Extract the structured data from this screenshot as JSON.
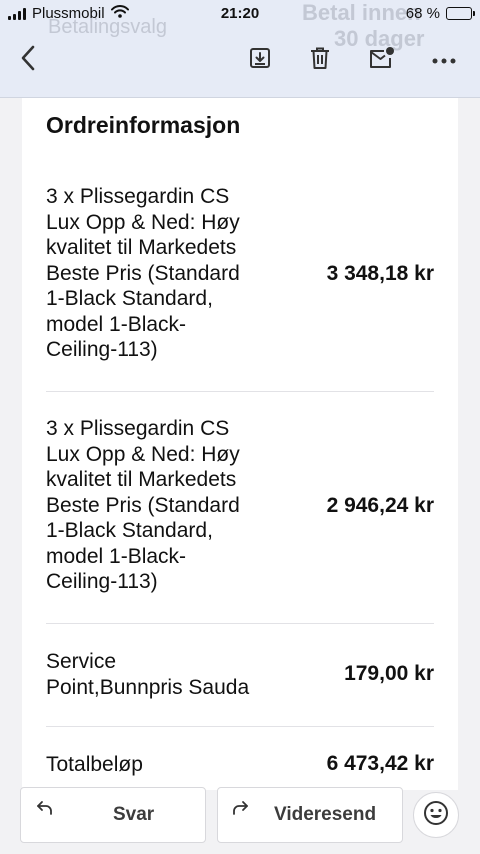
{
  "status_bar": {
    "carrier": "Plussmobil",
    "time": "21:20",
    "battery_percent": "68 %",
    "battery_level": 0.68
  },
  "background_header": {
    "left_text": "Betalingsvalg",
    "right_line1": "Betal innen",
    "right_line2": "30 dager"
  },
  "toolbar": {
    "back_icon": "back-arrow-icon",
    "archive_icon": "archive-icon",
    "delete_icon": "trash-icon",
    "unread_icon": "mark-unread-icon",
    "more_icon": "more-icon"
  },
  "order": {
    "title": "Ordreinformasjon",
    "items": [
      {
        "desc_lines": [
          "3 x Plissegardin CS",
          "Lux Opp & Ned: Høy",
          "kvalitet til Markedets",
          "Beste Pris (Standard",
          "1-Black Standard,",
          "model 1-Black-",
          "Ceiling-113)"
        ],
        "price": "3 348,18 kr"
      },
      {
        "desc_lines": [
          "3 x Plissegardin CS",
          "Lux Opp & Ned: Høy",
          "kvalitet til Markedets",
          "Beste Pris (Standard",
          "1-Black Standard,",
          "model 1-Black-",
          "Ceiling-113)"
        ],
        "price": "2 946,24 kr"
      },
      {
        "desc_lines": [
          "Service",
          "Point,Bunnpris Sauda"
        ],
        "price": "179,00 kr"
      }
    ],
    "total_label": "Totalbeløp",
    "total_value": "6 473,42 kr"
  },
  "actions": {
    "reply_label": "Svar",
    "forward_label": "Videresend",
    "emoji_icon": "emoji-icon"
  },
  "colors": {
    "header_bg": "#e6ebf6",
    "page_bg": "#f2f2f4"
  }
}
